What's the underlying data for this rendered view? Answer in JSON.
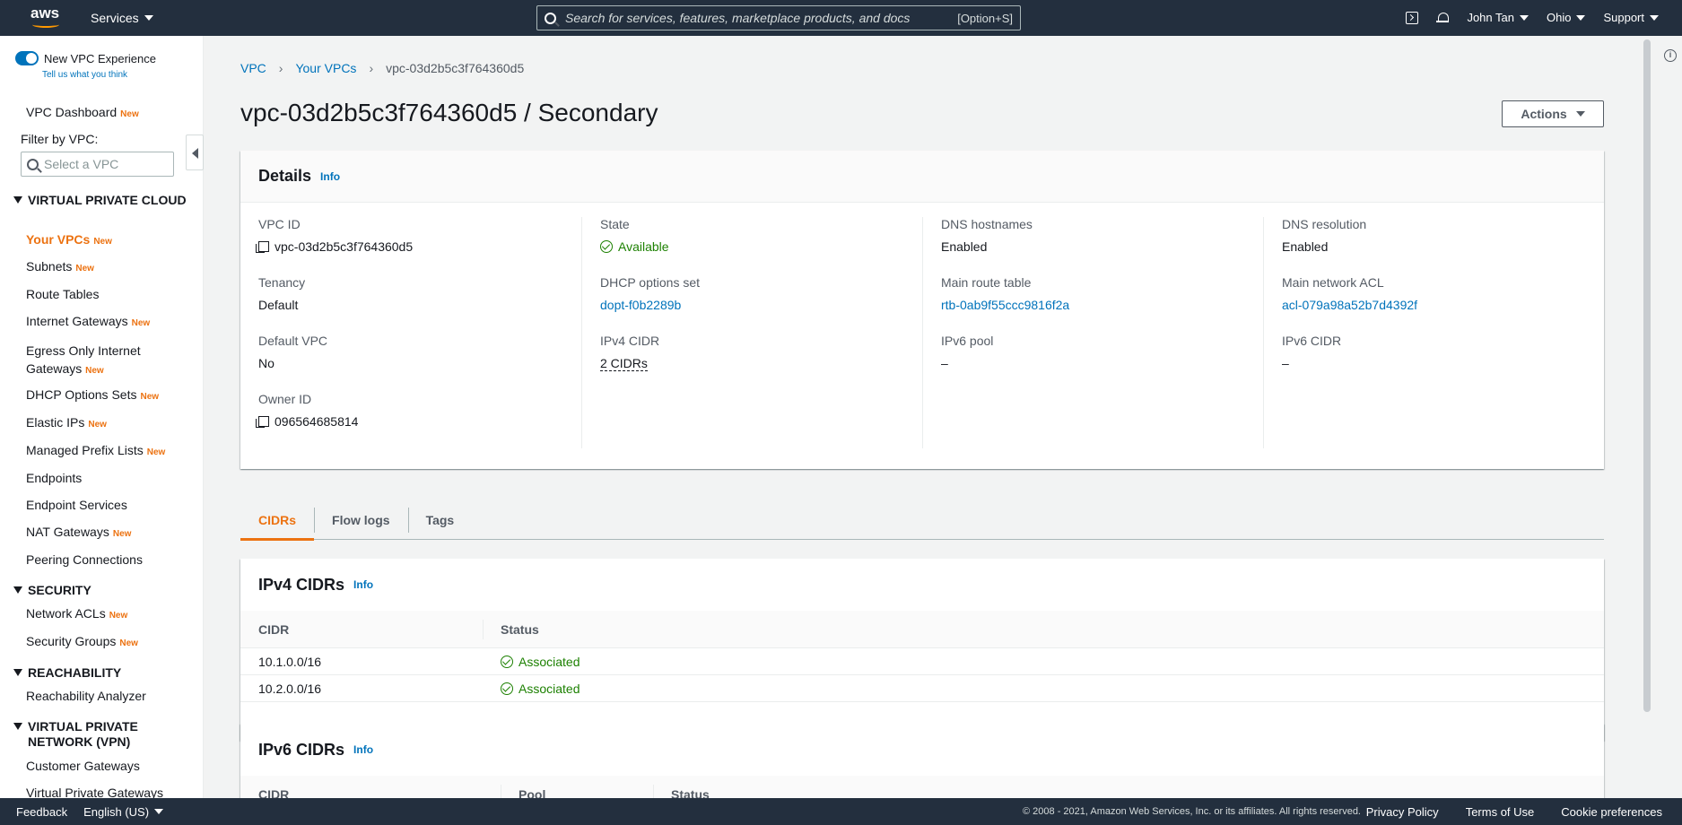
{
  "topbar": {
    "logo_text": "aws",
    "services_label": "Services",
    "search_placeholder": "Search for services, features, marketplace products, and docs",
    "search_shortcut": "[Option+S]",
    "user": "John Tan",
    "region": "Ohio",
    "support": "Support"
  },
  "sidebar": {
    "new_experience_label": "New VPC Experience",
    "tell_us": "Tell us what you think",
    "dashboard": "VPC Dashboard",
    "new_badge": "New",
    "filter_label": "Filter by VPC:",
    "filter_placeholder": "Select a VPC",
    "section_vpc": "VIRTUAL PRIVATE CLOUD",
    "items_vpc": [
      {
        "label": "Your VPCs",
        "new": "New"
      },
      {
        "label": "Subnets",
        "new": "New"
      },
      {
        "label": "Route Tables",
        "new": ""
      },
      {
        "label": "Internet Gateways",
        "new": "New"
      },
      {
        "label": "Egress Only Internet Gateways",
        "new": "New"
      },
      {
        "label": "DHCP Options Sets",
        "new": "New"
      },
      {
        "label": "Elastic IPs",
        "new": "New"
      },
      {
        "label": "Managed Prefix Lists",
        "new": "New"
      },
      {
        "label": "Endpoints",
        "new": ""
      },
      {
        "label": "Endpoint Services",
        "new": ""
      },
      {
        "label": "NAT Gateways",
        "new": "New"
      },
      {
        "label": "Peering Connections",
        "new": ""
      }
    ],
    "section_security": "SECURITY",
    "items_security": [
      {
        "label": "Network ACLs",
        "new": "New"
      },
      {
        "label": "Security Groups",
        "new": "New"
      }
    ],
    "section_reachability": "REACHABILITY",
    "items_reachability": [
      {
        "label": "Reachability Analyzer",
        "new": ""
      }
    ],
    "section_vpn": "VIRTUAL PRIVATE NETWORK (VPN)",
    "items_vpn": [
      {
        "label": "Customer Gateways",
        "new": ""
      },
      {
        "label": "Virtual Private Gateways",
        "new": ""
      }
    ]
  },
  "breadcrumb": {
    "root": "VPC",
    "parent": "Your VPCs",
    "current": "vpc-03d2b5c3f764360d5"
  },
  "page": {
    "title": "vpc-03d2b5c3f764360d5 / Secondary",
    "actions_label": "Actions"
  },
  "details": {
    "heading": "Details",
    "info": "Info",
    "vpc_id_label": "VPC ID",
    "vpc_id": "vpc-03d2b5c3f764360d5",
    "tenancy_label": "Tenancy",
    "tenancy": "Default",
    "default_vpc_label": "Default VPC",
    "default_vpc": "No",
    "owner_id_label": "Owner ID",
    "owner_id": "096564685814",
    "state_label": "State",
    "state": "Available",
    "dhcp_label": "DHCP options set",
    "dhcp": "dopt-f0b2289b",
    "ipv4_cidr_label": "IPv4 CIDR",
    "ipv4_cidr": "2 CIDRs",
    "dns_hostnames_label": "DNS hostnames",
    "dns_hostnames": "Enabled",
    "main_route_label": "Main route table",
    "main_route": "rtb-0ab9f55ccc9816f2a",
    "ipv6_pool_label": "IPv6 pool",
    "ipv6_pool": "–",
    "dns_resolution_label": "DNS resolution",
    "dns_resolution": "Enabled",
    "main_acl_label": "Main network ACL",
    "main_acl": "acl-079a98a52b7d4392f",
    "ipv6_cidr_label": "IPv6 CIDR",
    "ipv6_cidr": "–"
  },
  "tabs": [
    "CIDRs",
    "Flow logs",
    "Tags"
  ],
  "ipv4_table": {
    "heading": "IPv4 CIDRs",
    "info": "Info",
    "columns": [
      "CIDR",
      "Status"
    ],
    "rows": [
      {
        "cidr": "10.1.0.0/16",
        "status": "Associated"
      },
      {
        "cidr": "10.2.0.0/16",
        "status": "Associated"
      }
    ]
  },
  "ipv6_table": {
    "heading": "IPv6 CIDRs",
    "info": "Info",
    "columns": [
      "CIDR",
      "Pool",
      "Status"
    ]
  },
  "footer": {
    "feedback": "Feedback",
    "language": "English (US)",
    "copyright": "© 2008 - 2021, Amazon Web Services, Inc. or its affiliates. All rights reserved.",
    "privacy": "Privacy Policy",
    "terms": "Terms of Use",
    "cookies": "Cookie preferences"
  },
  "colors": {
    "nav_bg": "#232f3e",
    "link": "#0073bb",
    "accent": "#ec7211",
    "success": "#1d8102"
  }
}
